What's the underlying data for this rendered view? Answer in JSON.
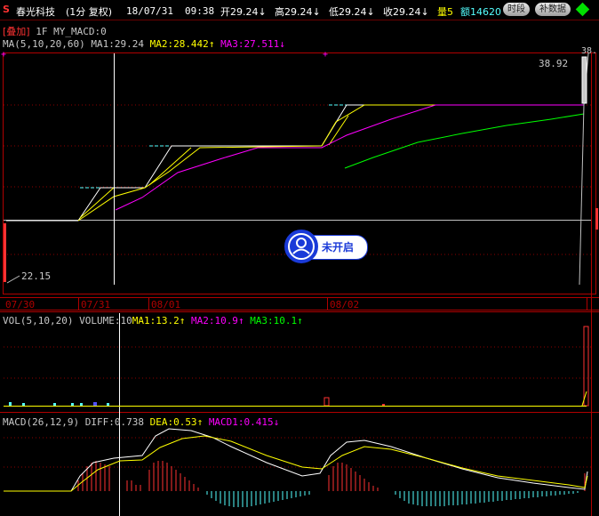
{
  "header": {
    "logo": "S",
    "stock_name": "春光科技",
    "period": "(1分 复权)",
    "date": "18/07/31",
    "time": "09:38",
    "open": "开29.24",
    "high": "高29.24",
    "low": "低29.24",
    "close": "收29.24",
    "volume_label": "量5",
    "amount_label": "额14620",
    "btn_time": "时段",
    "btn_fill": "补数据"
  },
  "overlay": {
    "tag": "[叠加]",
    "tag_rest": "1F MY_MACD:0"
  },
  "ma_line": {
    "name": "MA(5,10,20,60)",
    "ma1": "MA1:29.24",
    "ma2": "MA2:28.442",
    "ma3": "MA3:27.511"
  },
  "price": {
    "high_label": "38.92",
    "low_label": "22.15",
    "edge_label": "38."
  },
  "dates": [
    "07/30",
    "07/31",
    "08/01",
    "08/02"
  ],
  "vol_line": {
    "name": "VOL(5,10,20)",
    "volume": "VOLUME:10",
    "ma1": "MA1:13.2",
    "ma2": "MA2:10.9",
    "ma3": "MA3:10.1"
  },
  "macd_line": {
    "name": "MACD(26,12,9)",
    "diff": "DIFF:0.738",
    "dea": "DEA:0.53",
    "macd": "MACD1:0.415"
  },
  "toggle": {
    "label": "未开启"
  },
  "colors": {
    "ma1": "#ffff00",
    "ma2": "#ff00ff",
    "ma3": "#00ff00",
    "grid": "#8b0000",
    "up": "#ff3232",
    "down": "#54ffff",
    "accent": "#1a3ad8"
  }
}
